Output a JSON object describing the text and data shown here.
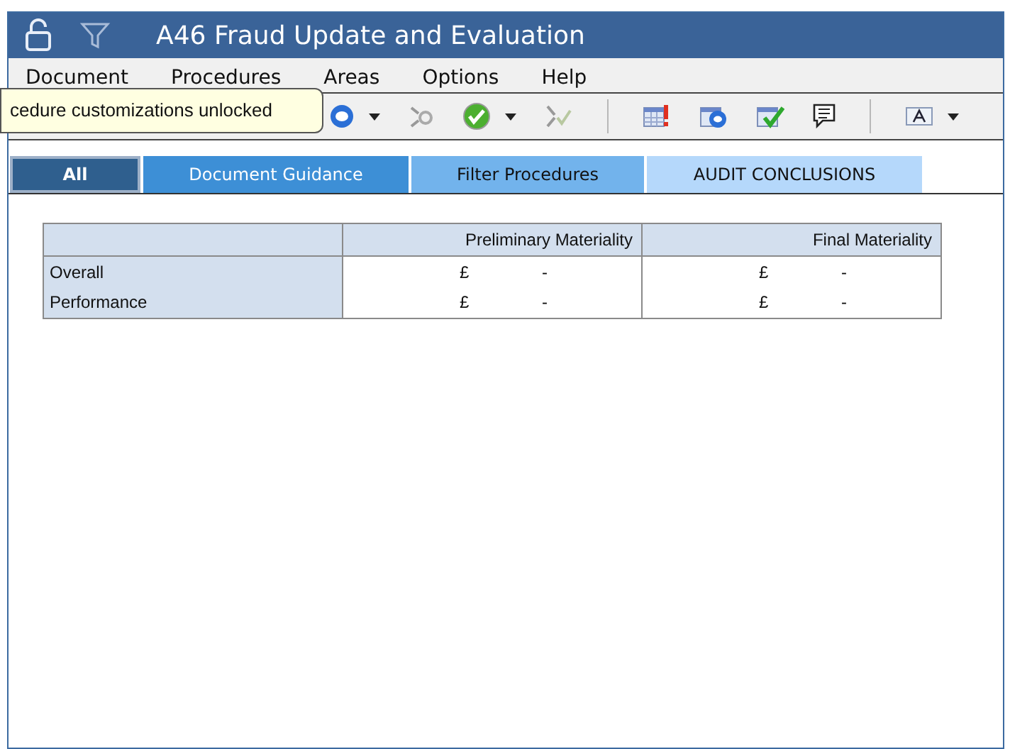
{
  "window": {
    "title": "A46 Fraud Update and Evaluation"
  },
  "menu": [
    "Document",
    "Procedures",
    "Areas",
    "Options",
    "Help"
  ],
  "tooltip": {
    "text": "cedure customizations unlocked"
  },
  "toolbar": [
    {
      "kind": "chat",
      "dropdown": true
    },
    {
      "kind": "link",
      "dropdown": false
    },
    {
      "kind": "check",
      "dropdown": true
    },
    {
      "kind": "merge",
      "dropdown": false
    },
    {
      "kind": "separator",
      "dropdown": false
    },
    {
      "kind": "table-alert",
      "dropdown": false
    },
    {
      "kind": "table-chat",
      "dropdown": false
    },
    {
      "kind": "table-check",
      "dropdown": false
    },
    {
      "kind": "comment",
      "dropdown": false
    },
    {
      "kind": "separator",
      "dropdown": false
    },
    {
      "kind": "font",
      "dropdown": true
    }
  ],
  "tabs": [
    {
      "label": "All",
      "selected": true,
      "color": "#2f5f8e"
    },
    {
      "label": "Document Guidance",
      "selected": false,
      "color": "#3d8fd6"
    },
    {
      "label": "Filter Procedures",
      "selected": false,
      "color": "#72b3ec"
    },
    {
      "label": "AUDIT CONCLUSIONS",
      "selected": false,
      "color": "#b5d8fb"
    }
  ],
  "table": {
    "columns": [
      "Preliminary Materiality",
      "Final Materiality"
    ],
    "rows": [
      {
        "label": "Overall",
        "cells": [
          {
            "currency": "£",
            "value": "-"
          },
          {
            "currency": "£",
            "value": "-"
          }
        ]
      },
      {
        "label": "Performance",
        "cells": [
          {
            "currency": "£",
            "value": "-"
          },
          {
            "currency": "£",
            "value": "-"
          }
        ]
      }
    ]
  }
}
